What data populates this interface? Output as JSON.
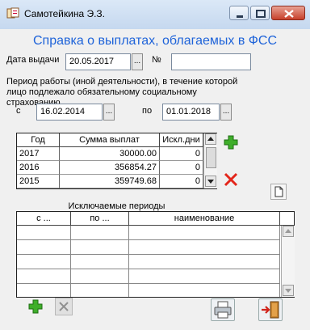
{
  "window": {
    "title": "Самотейкина Э.З."
  },
  "heading": "Справка о выплатах, облагаемых в ФСС",
  "issue": {
    "date_label": "Дата выдачи",
    "date_value": "20.05.2017",
    "num_label": "№",
    "num_value": ""
  },
  "period": {
    "description": "Период работы (иной деятельности), в течение которой лицо подлежало обязательному социальному страхованию",
    "from_label": "с",
    "from_value": "16.02.2014",
    "to_label": "по",
    "to_value": "01.01.2018"
  },
  "payments_table": {
    "columns": [
      "Год",
      "Сумма выплат",
      "Искл.дни"
    ],
    "rows": [
      {
        "year": "2017",
        "sum": "30000.00",
        "days": "0"
      },
      {
        "year": "2016",
        "sum": "356854.27",
        "days": "0"
      },
      {
        "year": "2015",
        "sum": "359749.68",
        "days": "0"
      }
    ]
  },
  "excluded": {
    "title": "Исключаемые периоды",
    "columns": [
      "с ...",
      "по ...",
      "наименование"
    ],
    "rows": []
  },
  "dot_label": "...",
  "colors": {
    "heading": "#1e63d9",
    "add_green": "#3fae2a",
    "delete_red": "#e3261b"
  }
}
